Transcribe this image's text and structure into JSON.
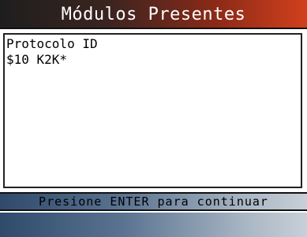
{
  "header": {
    "title": "Módulos Presentes"
  },
  "content": {
    "lines": [
      "Protocolo ID",
      "$10 K2K*"
    ]
  },
  "status": {
    "prompt": "Presione ENTER para continuar"
  },
  "colors": {
    "title_gradient_start": "#1e1e1e",
    "title_gradient_end": "#d2401c",
    "bar_gradient_start": "#2f4a6b",
    "bar_gradient_end": "#c8d0d8",
    "border": "#222222"
  }
}
